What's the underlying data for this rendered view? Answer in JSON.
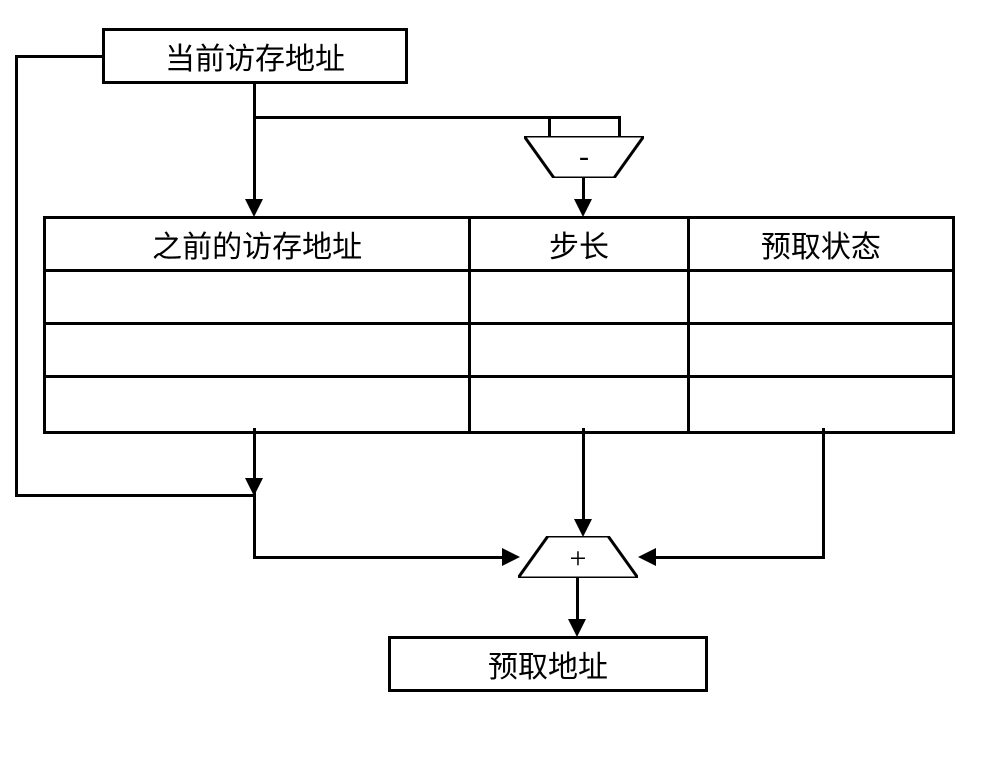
{
  "current_address_label": "当前访存地址",
  "table_headers": {
    "prev_address": "之前的访存地址",
    "stride": "步长",
    "prefetch_state": "预取状态"
  },
  "prefetch_address_label": "预取地址",
  "subtract_op": "-",
  "add_op": "+"
}
